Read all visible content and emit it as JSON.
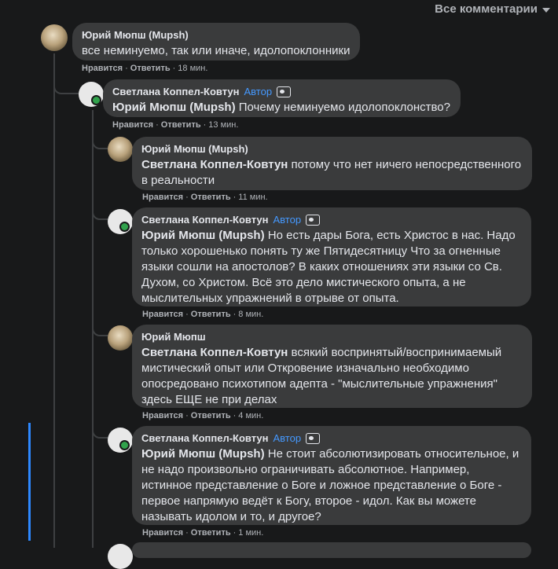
{
  "sort_label": "Все комментарии",
  "sep": "·",
  "comments": [
    {
      "author": "Юрий Мюпш (Mupsh)",
      "mention": "",
      "text": "все неминуемо, так или иначе, идолопоклонники",
      "like": "Нравится",
      "reply": "Ответить",
      "time": "18 мин."
    },
    {
      "author": "Светлана Коппел-Ковтун",
      "badge": "Автор",
      "mention": "Юрий Мюпш (Mupsh)",
      "text": "Почему неминуемо идолопоклонство?",
      "like": "Нравится",
      "reply": "Ответить",
      "time": "13 мин."
    },
    {
      "author": "Юрий Мюпш (Mupsh)",
      "mention": "Светлана Коппел-Ковтун",
      "text": "потому что нет ничего непосредственного в реальности",
      "like": "Нравится",
      "reply": "Ответить",
      "time": "11 мин."
    },
    {
      "author": "Светлана Коппел-Ковтун",
      "badge": "Автор",
      "mention": "Юрий Мюпш (Mupsh)",
      "text": "Но есть дары Бога, есть Христос в нас. Надо только хорошенько понять ту же Пятидесятницу Что за огненные языки сошли на апостолов? В каких отношениях эти языки со Св. Духом, со Христом. Всё это дело мистического опыта, а не мыслительных упражнений в отрыве от опыта.",
      "like": "Нравится",
      "reply": "Ответить",
      "time": "8 мин."
    },
    {
      "author": "Юрий Мюпш",
      "mention": "Светлана Коппел-Ковтун",
      "text": "всякий воспринятый/воспринимаемый мистический опыт или Откровение изначально необходимо опосредовано психотипом адепта - \"мыслительные упражнения\" здесь ЕЩЕ не при делах",
      "like": "Нравится",
      "reply": "Ответить",
      "time": "4 мин."
    },
    {
      "author": "Светлана Коппел-Ковтун",
      "badge": "Автор",
      "mention": "Юрий Мюпш (Mupsh)",
      "text": "Не стоит абсолютизировать относительное, и не надо произвольно ограничивать абсолютное. Например, истинное представление о Боге и ложное представление о Боге - первое напрямую ведёт к Богу, второе - идол. Как вы можете называть идолом и то, и другое?",
      "like": "Нравится",
      "reply": "Ответить",
      "time": "1 мин."
    }
  ]
}
